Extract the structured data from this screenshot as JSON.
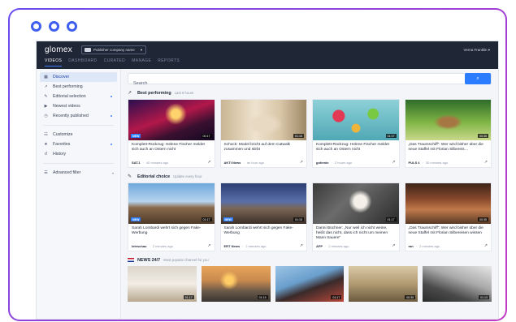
{
  "app": {
    "logo": "glomex",
    "publisher": "Publisher company name",
    "user": "Verna Franklin",
    "nav": [
      "VIDEOS",
      "DASHBOARD",
      "CURATED",
      "MANAGE",
      "REPORTS"
    ]
  },
  "sidebar": {
    "items": [
      {
        "label": "Discover",
        "icon": "grid-icon",
        "active": true
      },
      {
        "label": "Best performing",
        "icon": "trend-icon"
      },
      {
        "label": "Editorial selection",
        "icon": "pen-icon",
        "dot": true
      },
      {
        "label": "Newest videos",
        "icon": "play-icon"
      },
      {
        "label": "Recently published",
        "icon": "clock-icon",
        "dot": true
      },
      {
        "label": "Customize",
        "icon": "sliders-icon"
      },
      {
        "label": "Favorites",
        "icon": "star-icon",
        "dot": true
      },
      {
        "label": "History",
        "icon": "history-icon"
      },
      {
        "label": "Advanced filter",
        "icon": "filter-icon",
        "caret": true
      }
    ]
  },
  "search": {
    "placeholder": "Search",
    "button_icon": "search-icon"
  },
  "sections": {
    "best": {
      "title": "Best performing",
      "subtitle": "Last 6 hours",
      "cards": [
        {
          "title": "Komplett-Rückzug: Helene Fischer meldet sich auch an Ostern nicht",
          "source": "SAT.1",
          "time": "40 minutes ago",
          "duration": "00:17",
          "badge": "NEW"
        },
        {
          "title": "Schock: Model bricht auf dem Catwalk zusammen und stirbt",
          "source": "AKTI News",
          "time": "an hour ago",
          "duration": "01:15",
          "badge": ""
        },
        {
          "title": "Komplett-Rückzug: Helene Fischer meldet sich auch an Ostern nicht",
          "source": "gofemin",
          "time": "2 hours ago",
          "duration": "01:17",
          "badge": ""
        },
        {
          "title": "„Das Traumschiff“: Wer wird bisher über die neue Staffel mit Florian Silbereis…",
          "source": "PULS 4",
          "time": "30 minutes ago",
          "duration": "00:35",
          "badge": ""
        }
      ]
    },
    "editorial": {
      "title": "Editorial choice",
      "subtitle": "Update every hour",
      "cards": [
        {
          "title": "Sarah Lombardi wehrt sich gegen Fake-Werbung",
          "source": "teleschau",
          "time": "2 minutes ago",
          "duration": "01:17",
          "badge": "NEW"
        },
        {
          "title": "Sarah Lombardi wehrt sich gegen Fake-Werbung",
          "source": "ERT News",
          "time": "2 minutes ago",
          "duration": "01:15",
          "badge": "NEW"
        },
        {
          "title": "Danni Büchner: „Nur weil ich nicht weine, heißt das nicht, dass ich nicht um meinen Mann trauere“",
          "source": "AFP",
          "time": "2 minutes ago",
          "duration": "01:17",
          "badge": ""
        },
        {
          "title": "„Das Traumschiff“: Wer wird bisher über die neue Staffel mit Florian Silbereisen wissen",
          "source": "ran",
          "time": "2 minutes ago",
          "duration": "00:35",
          "badge": ""
        }
      ]
    },
    "news": {
      "title": "NEWS 24/7",
      "subtitle": "Most popular channel for you",
      "durations": [
        "01:17",
        "01:15",
        "01:17",
        "00:35",
        "01:13"
      ]
    }
  },
  "colors": {
    "accent": "#2b7cff",
    "topbar": "#1f2636",
    "frame_start": "#6a4cf0",
    "frame_end": "#c23bc4"
  }
}
